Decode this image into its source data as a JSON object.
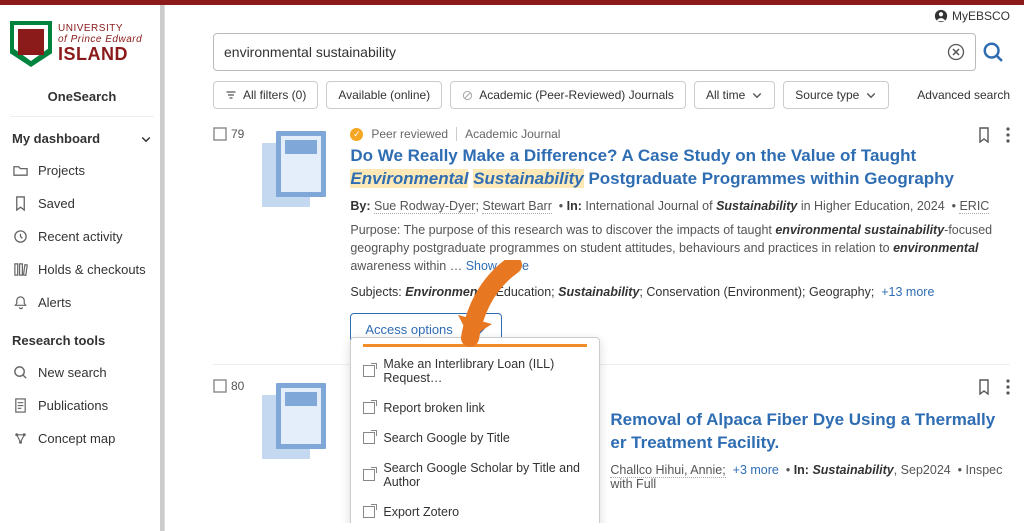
{
  "brand": {
    "line1": "UNIVERSITY",
    "line2": "of Prince Edward",
    "line3": "ISLAND"
  },
  "sidebar": {
    "onesearch": "OneSearch",
    "dashboard_heading": "My dashboard",
    "items": [
      {
        "label": "Projects"
      },
      {
        "label": "Saved"
      },
      {
        "label": "Recent activity"
      },
      {
        "label": "Holds & checkouts"
      },
      {
        "label": "Alerts"
      }
    ],
    "research_tools_heading": "Research tools",
    "tools": [
      {
        "label": "New search"
      },
      {
        "label": "Publications"
      },
      {
        "label": "Concept map"
      }
    ]
  },
  "myebsco": "MyEBSCO",
  "search": {
    "query": "environmental sustainability"
  },
  "filters": {
    "all": "All filters (0)",
    "available": "Available (online)",
    "peer": "Academic (Peer-Reviewed) Journals",
    "time": "All time",
    "source": "Source type",
    "advanced": "Advanced search"
  },
  "results": {
    "r1": {
      "num": "79",
      "peer": "Peer reviewed",
      "type": "Academic Journal",
      "title_a": "Do We Really Make a Difference? A Case Study on the Value of Taught ",
      "title_hl1": "Environmental",
      "title_hl2": "Sustainability",
      "title_b": " Postgraduate Programmes within Geography",
      "by_label": "By:",
      "author1": "Sue Rodway-Dyer",
      "author2": "Stewart Barr",
      "in_label": "In:",
      "journal_a": "International Journal of ",
      "journal_b": "Sustainability",
      "journal_c": " in Higher Education, 2024",
      "source": "ERIC",
      "abstract_a": "Purpose: The purpose of this research was to discover the impacts of taught ",
      "abstract_b": "environmental sustainability",
      "abstract_c": "-focused geography postgraduate programmes on student attitudes, behaviours and practices in relation to ",
      "abstract_d": "environmental",
      "abstract_e": " awareness within … ",
      "show_more": "Show more",
      "subjects_label": "Subjects:",
      "subj1": "Environmental",
      "subj1b": " Education;",
      "subj2": "Sustainability",
      "subj2b": ";",
      "subj3": "Conservation (Environment);",
      "subj4": "Geography;",
      "plus_more": "+13 more",
      "access": "Access options"
    },
    "r2": {
      "num": "80",
      "title_a": "Removal of Alpaca Fiber Dye Using a Thermally",
      "title_b": "er Treatment Facility.",
      "by_tail_a": "Challco Hihui, Annie;",
      "plus_more": "+3 more",
      "in_label": "In:",
      "journal": "Sustainability",
      "date": ", Sep2024",
      "src": "Inspec with Full"
    }
  },
  "access_menu": {
    "i1": "Make an Interlibrary Loan (ILL) Request…",
    "i2": "Report broken link",
    "i3": "Search Google by Title",
    "i4": "Search Google Scholar by Title and Author",
    "i5": "Export Zotero"
  }
}
